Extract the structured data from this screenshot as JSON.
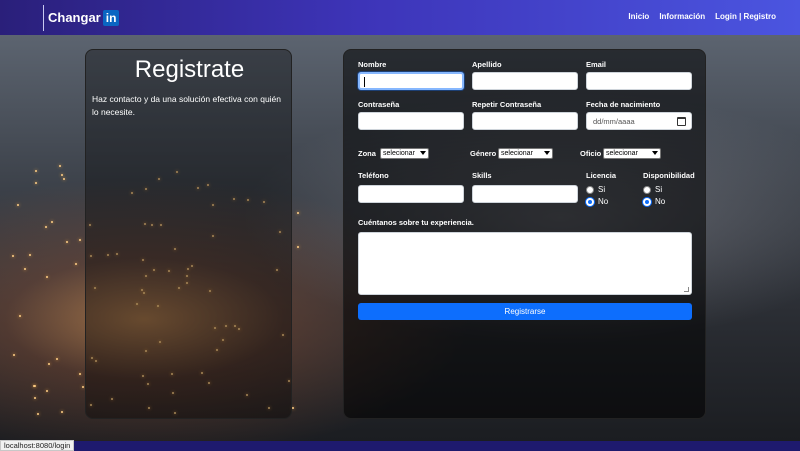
{
  "navbar": {
    "brand_text": "Changar",
    "brand_badge": "in",
    "links": [
      "Inicio",
      "Información",
      "Login | Registro"
    ]
  },
  "intro": {
    "title": "Registrate",
    "description": "Haz contacto y da una solución efectiva con quién lo necesite."
  },
  "form": {
    "nombre_label": "Nombre",
    "nombre_value": "",
    "apellido_label": "Apellido",
    "email_label": "Email",
    "contrasena_label": "Contraseña",
    "repetir_label": "Repetir Contraseña",
    "fecha_label": "Fecha de nacimiento",
    "fecha_placeholder": "dd/mm/aaaa",
    "zona_label": "Zona",
    "zona_value": "selecionar",
    "genero_label": "Género",
    "genero_value": "selecionar",
    "oficio_label": "Oficio",
    "oficio_value": "selecionar",
    "telefono_label": "Teléfono",
    "skills_label": "Skills",
    "licencia_label": "Licencia",
    "licencia_options": [
      "Si",
      "No"
    ],
    "licencia_selected": "No",
    "disponibilidad_label": "Disponibilidad",
    "disponibilidad_options": [
      "Si",
      "No"
    ],
    "disponibilidad_selected": "No",
    "experiencia_label": "Cuéntanos sobre tu experiencia.",
    "submit_label": "Registrarse"
  },
  "status_bar": {
    "url": "localhost:8080/login"
  },
  "colors": {
    "navbar_start": "#2a1f7a",
    "navbar_end": "#4b55e0",
    "primary_button": "#0d6efd",
    "bottom_bar": "#1e1a6e"
  },
  "icons": [
    "calendar-icon",
    "select-arrow-icon"
  ]
}
